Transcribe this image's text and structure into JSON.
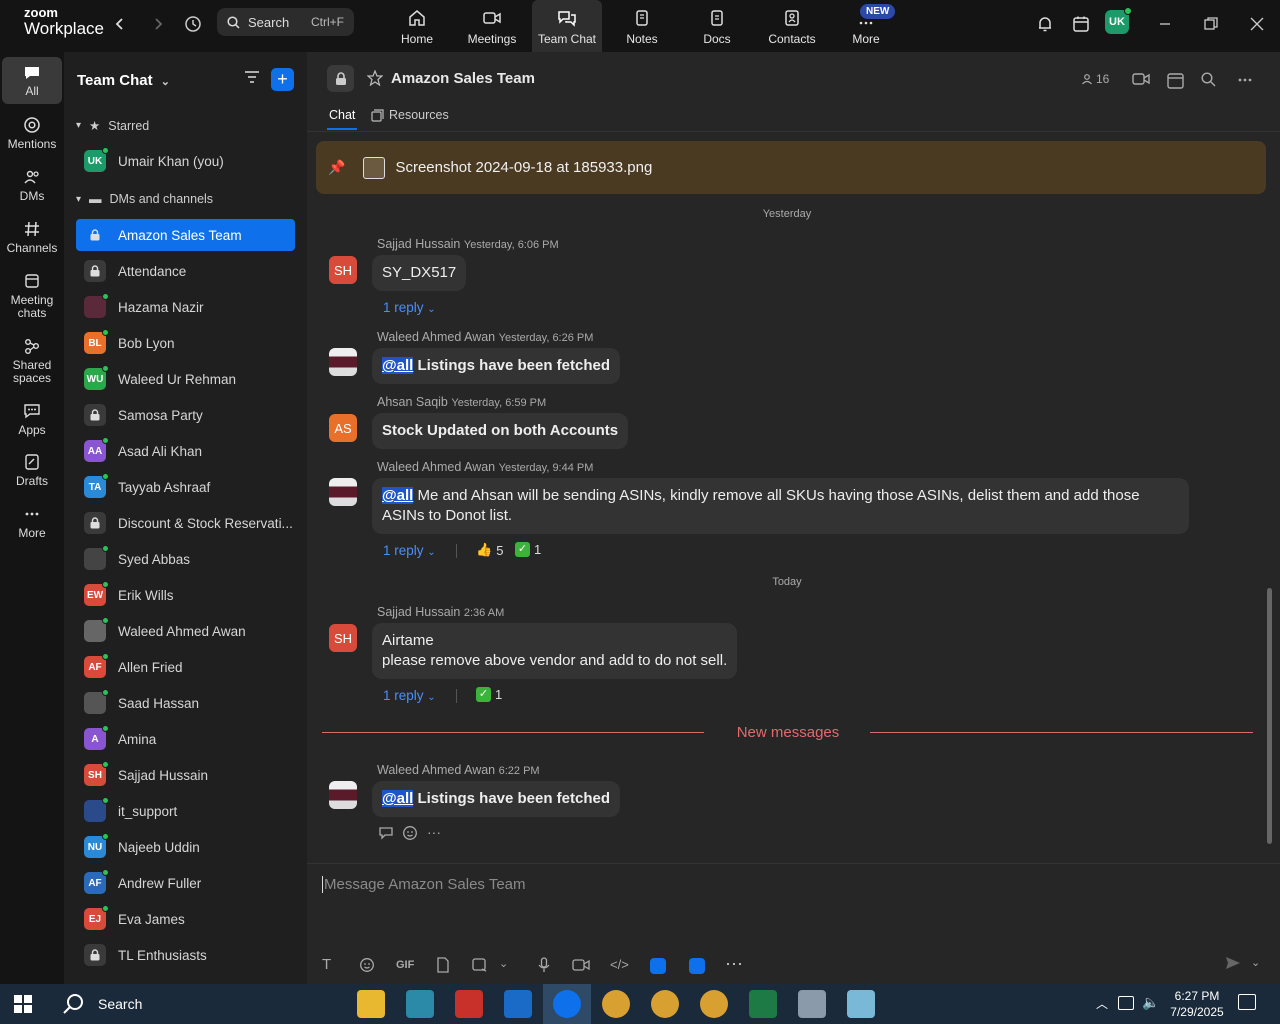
{
  "topbar": {
    "logo_line1": "zoom",
    "logo_line2": "Workplace",
    "search_label": "Search",
    "search_shortcut": "Ctrl+F",
    "nav": [
      {
        "label": "Home"
      },
      {
        "label": "Meetings"
      },
      {
        "label": "Team Chat"
      },
      {
        "label": "Notes"
      },
      {
        "label": "Docs"
      },
      {
        "label": "Contacts"
      },
      {
        "label": "More"
      }
    ],
    "new_badge": "NEW",
    "user_initials": "UK"
  },
  "rail": [
    {
      "label": "All"
    },
    {
      "label": "Mentions"
    },
    {
      "label": "DMs"
    },
    {
      "label": "Channels"
    },
    {
      "label": "Meeting chats"
    },
    {
      "label": "Shared spaces"
    },
    {
      "label": "Apps"
    },
    {
      "label": "Drafts"
    },
    {
      "label": "More"
    }
  ],
  "sidebar": {
    "title": "Team Chat",
    "starred_label": "Starred",
    "dms_label": "DMs and channels",
    "starred": [
      {
        "initials": "UK",
        "name": "Umair Khan (you)",
        "color": "#1c9a6a"
      }
    ],
    "items": [
      {
        "initials": "",
        "name": "Amazon Sales Team",
        "color": "#0e71eb",
        "lock": true
      },
      {
        "initials": "",
        "name": "Attendance",
        "color": "#3a3a3a",
        "lock": true
      },
      {
        "initials": "",
        "name": "Hazama Nazir",
        "color": "#5a2a3a"
      },
      {
        "initials": "BL",
        "name": "Bob Lyon",
        "color": "#e8702a"
      },
      {
        "initials": "WU",
        "name": "Waleed Ur Rehman",
        "color": "#2aa84a"
      },
      {
        "initials": "",
        "name": "Samosa Party",
        "color": "#3a3a3a",
        "lock": true
      },
      {
        "initials": "AA",
        "name": "Asad Ali Khan",
        "color": "#8a55d0"
      },
      {
        "initials": "TA",
        "name": "Tayyab Ashraaf",
        "color": "#2a8ad8"
      },
      {
        "initials": "",
        "name": "Discount & Stock Reservati...",
        "color": "#3a3a3a",
        "lock": true
      },
      {
        "initials": "",
        "name": "Syed Abbas",
        "color": "#444"
      },
      {
        "initials": "EW",
        "name": "Erik Wills",
        "color": "#d84a3a"
      },
      {
        "initials": "",
        "name": "Waleed Ahmed Awan",
        "color": "#666"
      },
      {
        "initials": "AF",
        "name": "Allen Fried",
        "color": "#d84a3a"
      },
      {
        "initials": "",
        "name": "Saad Hassan",
        "color": "#555"
      },
      {
        "initials": "A",
        "name": "Amina",
        "color": "#8a55d0"
      },
      {
        "initials": "SH",
        "name": "Sajjad Hussain",
        "color": "#d84a3a"
      },
      {
        "initials": "",
        "name": "it_support",
        "color": "#2a4a8a"
      },
      {
        "initials": "NU",
        "name": "Najeeb Uddin",
        "color": "#2a8ad8"
      },
      {
        "initials": "AF",
        "name": "Andrew Fuller",
        "color": "#2a6ab8"
      },
      {
        "initials": "EJ",
        "name": "Eva James",
        "color": "#d84a3a"
      },
      {
        "initials": "",
        "name": "TL Enthusiasts",
        "color": "#3a3a3a",
        "lock": true
      }
    ]
  },
  "channel": {
    "title": "Amazon Sales Team",
    "members": "16",
    "tabs": [
      {
        "label": "Chat"
      },
      {
        "label": "Resources"
      }
    ],
    "pinned_file": "Screenshot 2024-09-18 at 185933.png"
  },
  "messages": {
    "day_yesterday": "Yesterday",
    "day_today": "Today",
    "new_messages": "New messages",
    "list": [
      {
        "avatar": "SH",
        "name": "Sajjad Hussain",
        "time": "Yesterday, 6:06 PM",
        "text": "SY_DX517",
        "reply": "1 reply"
      },
      {
        "avatar": "",
        "name": "Waleed Ahmed Awan",
        "time": "Yesterday, 6:26 PM",
        "mention": "@all",
        "text": " Listings have been fetched"
      },
      {
        "avatar": "AS",
        "name": "Ahsan Saqib",
        "time": "Yesterday, 6:59 PM",
        "text": "Stock Updated on both Accounts"
      },
      {
        "avatar": "",
        "name": "Waleed Ahmed Awan",
        "time": "Yesterday, 9:44 PM",
        "mention": "@all",
        "text": " Me and Ahsan will be sending ASINs, kindly remove all SKUs having those ASINs, delist them and add those ASINs to Donot list.",
        "reply": "1 reply",
        "reactions": [
          {
            "emoji": "👍",
            "count": "5"
          },
          {
            "emoji": "✅",
            "count": "1"
          }
        ]
      },
      {
        "avatar": "SH",
        "name": "Sajjad Hussain",
        "time": "2:36 AM",
        "text_line1": "Airtame",
        "text_line2": "please remove above vendor and add to do not sell.",
        "reply": "1 reply",
        "reactions": [
          {
            "emoji": "✅",
            "count": "1"
          }
        ]
      },
      {
        "avatar": "",
        "name": "Waleed Ahmed Awan",
        "time": "6:22 PM",
        "mention": "@all",
        "text": " Listings have been fetched"
      }
    ]
  },
  "composer": {
    "placeholder": "Message Amazon Sales Team",
    "gif_label": "GIF"
  },
  "taskbar": {
    "search_label": "Search",
    "time": "6:27 PM",
    "date": "7/29/2025"
  }
}
